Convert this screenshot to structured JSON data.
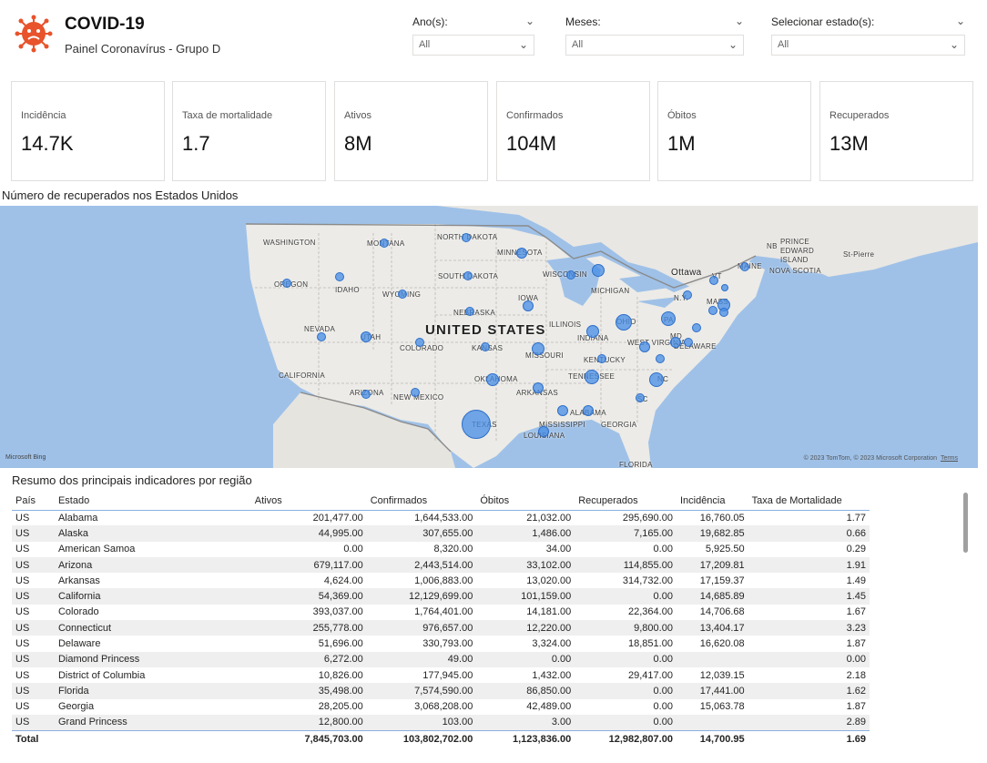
{
  "header": {
    "title": "COVID-19",
    "subtitle": "Painel Coronavírus - Grupo D",
    "logo_icon": "virus-icon",
    "logo_color": "#e8532b"
  },
  "filters": [
    {
      "label": "Ano(s):",
      "value": "All"
    },
    {
      "label": "Meses:",
      "value": "All"
    },
    {
      "label": "Selecionar estado(s):",
      "value": "All"
    }
  ],
  "kpis": [
    {
      "label": "Incidência",
      "value": "14.7K"
    },
    {
      "label": "Taxa de mortalidade",
      "value": "1.7"
    },
    {
      "label": "Ativos",
      "value": "8M"
    },
    {
      "label": "Confirmados",
      "value": "104M"
    },
    {
      "label": "Óbitos",
      "value": "1M"
    },
    {
      "label": "Recuperados",
      "value": "13M"
    }
  ],
  "map": {
    "title": "Número de recuperados nos Estados Unidos",
    "country_label": "UNITED STATES",
    "labels": [
      "WASHINGTON",
      "MONTANA",
      "NORTH DAKOTA",
      "MINNESOTA",
      "SOUTH DAKOTA",
      "WISCONSIN",
      "MICHIGAN",
      "OREGON",
      "IDAHO",
      "WYOMING",
      "IOWA",
      "NEBRASKA",
      "NEVADA",
      "UTAH",
      "COLORADO",
      "KANSAS",
      "ILLINOIS",
      "INDIANA",
      "OHIO",
      "MISSOURI",
      "CALIFORNIA",
      "OKLAHOMA",
      "ARKANSAS",
      "TENNESSEE",
      "KENTUCKY",
      "WEST VIRGINIA",
      "ARIZONA",
      "NEW MEXICO",
      "TEXAS",
      "MISSISSIPPI",
      "ALABAMA",
      "GEORGIA",
      "LOUISIANA",
      "FLORIDA",
      "PA",
      "N.Y.",
      "MAINE",
      "VT",
      "MASS.",
      "MD",
      "DELAWARE",
      "NC",
      "SC",
      "NB",
      "PRINCE EDWARD ISLAND",
      "NOVA SCOTIA",
      "St-Pierre",
      "Ottawa"
    ],
    "attribution": "Microsoft Bing",
    "copyright": "© 2023 TomTom, © 2023 Microsoft Corporation",
    "terms": "Terms",
    "bubble_color": "#468ce6"
  },
  "table": {
    "title": "Resumo dos principais indicadores por região",
    "columns": [
      "País",
      "Estado",
      "Ativos",
      "Confirmados",
      "Óbitos",
      "Recuperados",
      "Incidência",
      "Taxa de Mortalidade"
    ],
    "rows": [
      [
        "US",
        "Alabama",
        "201,477.00",
        "1,644,533.00",
        "21,032.00",
        "295,690.00",
        "16,760.05",
        "1.77"
      ],
      [
        "US",
        "Alaska",
        "44,995.00",
        "307,655.00",
        "1,486.00",
        "7,165.00",
        "19,682.85",
        "0.66"
      ],
      [
        "US",
        "American Samoa",
        "0.00",
        "8,320.00",
        "34.00",
        "0.00",
        "5,925.50",
        "0.29"
      ],
      [
        "US",
        "Arizona",
        "679,117.00",
        "2,443,514.00",
        "33,102.00",
        "114,855.00",
        "17,209.81",
        "1.91"
      ],
      [
        "US",
        "Arkansas",
        "4,624.00",
        "1,006,883.00",
        "13,020.00",
        "314,732.00",
        "17,159.37",
        "1.49"
      ],
      [
        "US",
        "California",
        "54,369.00",
        "12,129,699.00",
        "101,159.00",
        "0.00",
        "14,685.89",
        "1.45"
      ],
      [
        "US",
        "Colorado",
        "393,037.00",
        "1,764,401.00",
        "14,181.00",
        "22,364.00",
        "14,706.68",
        "1.67"
      ],
      [
        "US",
        "Connecticut",
        "255,778.00",
        "976,657.00",
        "12,220.00",
        "9,800.00",
        "13,404.17",
        "3.23"
      ],
      [
        "US",
        "Delaware",
        "51,696.00",
        "330,793.00",
        "3,324.00",
        "18,851.00",
        "16,620.08",
        "1.87"
      ],
      [
        "US",
        "Diamond Princess",
        "6,272.00",
        "49.00",
        "0.00",
        "0.00",
        "",
        "0.00"
      ],
      [
        "US",
        "District of Columbia",
        "10,826.00",
        "177,945.00",
        "1,432.00",
        "29,417.00",
        "12,039.15",
        "2.18"
      ],
      [
        "US",
        "Florida",
        "35,498.00",
        "7,574,590.00",
        "86,850.00",
        "0.00",
        "17,441.00",
        "1.62"
      ],
      [
        "US",
        "Georgia",
        "28,205.00",
        "3,068,208.00",
        "42,489.00",
        "0.00",
        "15,063.78",
        "1.87"
      ],
      [
        "US",
        "Grand Princess",
        "12,800.00",
        "103.00",
        "3.00",
        "0.00",
        "",
        "2.89"
      ]
    ],
    "total": [
      "Total",
      "",
      "7,845,703.00",
      "103,802,702.00",
      "1,123,836.00",
      "12,982,807.00",
      "14,700.95",
      "1.69"
    ]
  }
}
